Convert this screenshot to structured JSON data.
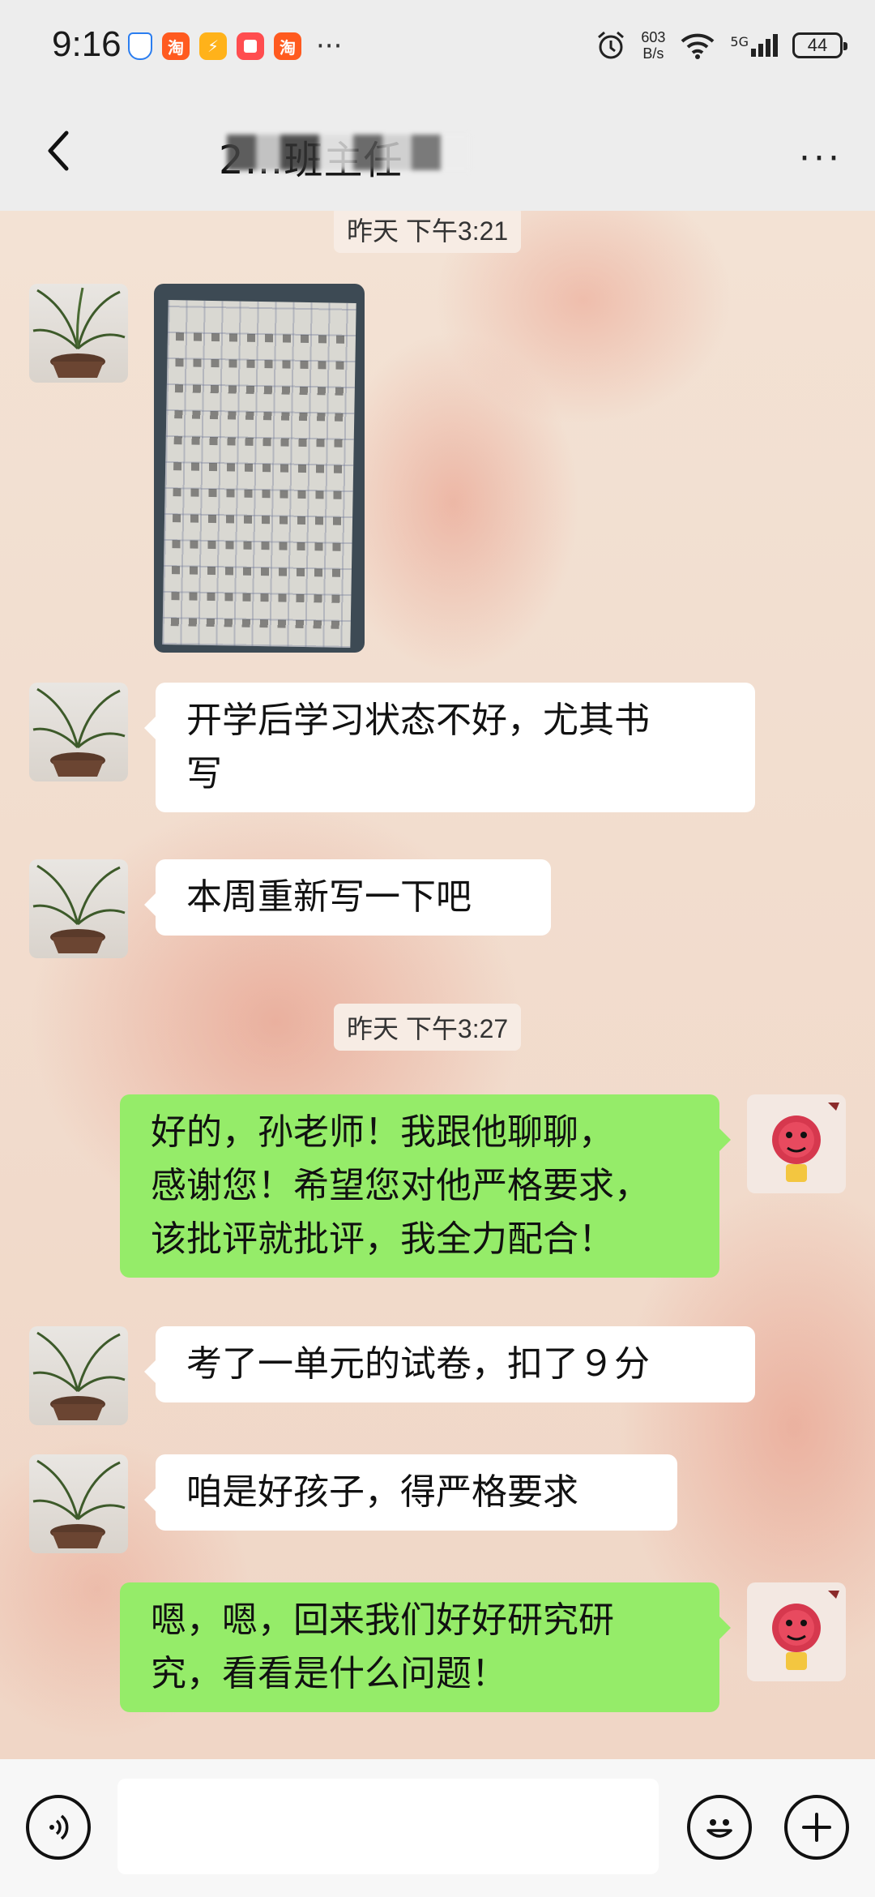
{
  "status_bar": {
    "time": "9:16",
    "app_icons": [
      "taobao-icon",
      "lightning-app-icon",
      "square-app-icon",
      "taobao-icon"
    ],
    "overflow": "···",
    "net_speed_value": "603",
    "net_speed_unit": "B/s",
    "network": "5G",
    "battery": "44"
  },
  "header": {
    "back_icon": "chevron-left-icon",
    "title": "2…班主任",
    "more": "···"
  },
  "messages": [
    {
      "type": "time",
      "text": "昨天 下午3:21"
    },
    {
      "type": "image",
      "side": "left",
      "avatar": "orchid"
    },
    {
      "type": "text",
      "side": "left",
      "lines": [
        "开学后学习状态不好，尤其书",
        "写"
      ]
    },
    {
      "type": "text",
      "side": "left",
      "lines": [
        "本周重新写一下吧"
      ]
    },
    {
      "type": "time",
      "text": "昨天 下午3:27"
    },
    {
      "type": "text",
      "side": "right",
      "lines": [
        "好的，孙老师！我跟他聊聊，",
        "感谢您！希望您对他严格要求，",
        "该批评就批评，我全力配合！"
      ]
    },
    {
      "type": "text",
      "side": "left",
      "lines": [
        "考了一单元的试卷，扣了９分"
      ]
    },
    {
      "type": "text",
      "side": "left",
      "lines": [
        "咱是好孩子，得严格要求"
      ]
    },
    {
      "type": "text",
      "side": "right",
      "lines": [
        "嗯，嗯，回来我们好好研究研",
        "究，看看是什么问题！"
      ]
    }
  ],
  "input_bar": {
    "voice_icon": "voice-icon",
    "emoji_icon": "emoji-icon",
    "plus_icon": "plus-icon",
    "input_value": ""
  },
  "colors": {
    "bubble_self": "#95ec69",
    "bubble_other": "#ffffff",
    "bar_bg": "#ededed"
  }
}
